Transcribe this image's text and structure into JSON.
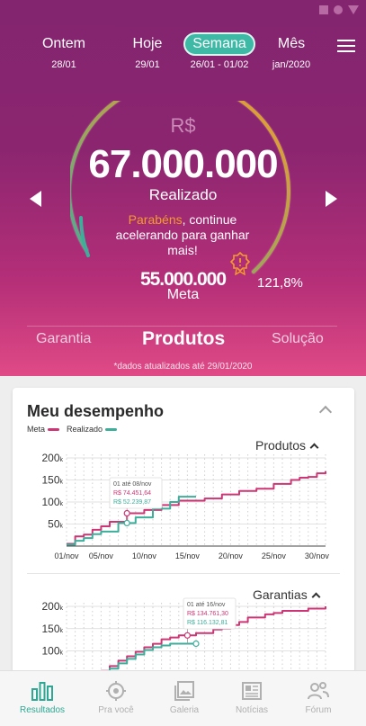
{
  "period_tabs": [
    {
      "label": "Ontem",
      "date": "28/01",
      "active": false
    },
    {
      "label": "Hoje",
      "date": "29/01",
      "active": false
    },
    {
      "label": "Semana",
      "date": "26/01 - 01/02",
      "active": true
    },
    {
      "label": "Mês",
      "date": "jan/2020",
      "active": false
    }
  ],
  "hero": {
    "currency": "R$",
    "value": "67.000.000",
    "value_label": "Realizado",
    "congrats_highlight": "Parabéns",
    "congrats_rest": ", continue acelerando para ganhar mais!",
    "meta_value": "55.000.000",
    "meta_label": "Meta",
    "percent": "121,8%",
    "gauge_progress": 1.218
  },
  "product_tabs": [
    {
      "label": "Garantia",
      "active": false
    },
    {
      "label": "Produtos",
      "active": true
    },
    {
      "label": "Solução",
      "active": false
    }
  ],
  "updated_note": "*dados atualizados até 29/01/2020",
  "performance": {
    "title": "Meu desempenho",
    "legend_meta": "Meta",
    "legend_realizado": "Realizado"
  },
  "colors": {
    "meta": "#cc3674",
    "realizado": "#3eae9b",
    "accent": "#2ea892",
    "hero_top": "#83256f",
    "hero_bottom": "#e04a86",
    "gauge_orange": "#f39c2c"
  },
  "chart_data": [
    {
      "type": "line",
      "title": "Produtos",
      "x_ticks": [
        "01/nov",
        "05/nov",
        "10/nov",
        "15/nov",
        "20/nov",
        "25/nov",
        "30/nov"
      ],
      "y_ticks": [
        "50k",
        "100k",
        "150k",
        "200k"
      ],
      "ylim": [
        0,
        200000
      ],
      "x": [
        1,
        2,
        3,
        4,
        5,
        6,
        7,
        8,
        9,
        10,
        11,
        12,
        13,
        14,
        15,
        16,
        17,
        18,
        19,
        20,
        21,
        22,
        23,
        24,
        25,
        26,
        27,
        28,
        29,
        30,
        31
      ],
      "series": [
        {
          "name": "Meta",
          "values": [
            5000,
            22000,
            26000,
            37000,
            45000,
            55000,
            55000,
            74452,
            74452,
            82000,
            82000,
            93000,
            93000,
            103000,
            103000,
            103000,
            108000,
            108000,
            117000,
            117000,
            125000,
            125000,
            130000,
            130000,
            141000,
            141000,
            150000,
            155000,
            157000,
            165000,
            170000
          ]
        },
        {
          "name": "Realizado",
          "values": [
            3000,
            12000,
            18000,
            27000,
            33000,
            33000,
            52240,
            52240,
            65000,
            65000,
            85000,
            85000,
            100000,
            112000,
            112000,
            112000
          ]
        }
      ],
      "tooltip": {
        "title": "01 até 08/nov",
        "meta": "R$ 74.451,64",
        "realizado": "R$ 52.239,87"
      }
    },
    {
      "type": "line",
      "title": "Garantias",
      "x_ticks": [],
      "y_ticks": [
        "100k",
        "150k",
        "200k"
      ],
      "ylim": [
        0,
        200000
      ],
      "x": [
        1,
        2,
        3,
        4,
        5,
        6,
        7,
        8,
        9,
        10,
        11,
        12,
        13,
        14,
        15,
        16,
        17,
        18,
        19,
        20,
        21,
        22,
        23,
        24,
        25,
        26,
        27,
        28,
        29,
        30,
        31
      ],
      "series": [
        {
          "name": "Meta",
          "values": [
            20000,
            28000,
            36000,
            45000,
            55000,
            66000,
            78000,
            88000,
            98000,
            108000,
            116000,
            126000,
            130000,
            134761,
            134761,
            140000,
            140000,
            148000,
            150000,
            158000,
            165000,
            175000,
            175000,
            182000,
            185000,
            190000,
            190000,
            190000,
            195000,
            195000,
            200000
          ]
        },
        {
          "name": "Realizado",
          "values": [
            15000,
            24000,
            32000,
            40000,
            50000,
            60000,
            72000,
            82000,
            92000,
            102000,
            108000,
            112000,
            116133,
            116133,
            116133,
            116133
          ]
        }
      ],
      "tooltip": {
        "title": "01 até 16/nov",
        "meta": "R$ 134.761,30",
        "realizado": "R$ 116.132,81"
      }
    }
  ],
  "bottom_nav": [
    {
      "label": "Resultados",
      "icon": "bar-chart-icon",
      "active": true
    },
    {
      "label": "Pra você",
      "icon": "target-icon",
      "active": false
    },
    {
      "label": "Galeria",
      "icon": "image-icon",
      "active": false
    },
    {
      "label": "Notícias",
      "icon": "newspaper-icon",
      "active": false
    },
    {
      "label": "Fórum",
      "icon": "people-icon",
      "active": false
    }
  ]
}
